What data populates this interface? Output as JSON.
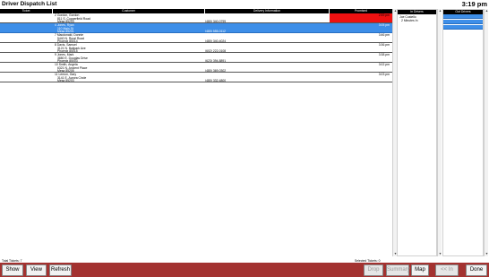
{
  "app": {
    "title": "Driver Dispatch List",
    "clock": "3:19 pm"
  },
  "main": {
    "columns": [
      "Ticket",
      "Customer",
      "Delivery Information",
      "Promised"
    ],
    "rows": [
      {
        "customer": "2 Gordon, Gordon",
        "address": "811 S. Copperfield Road",
        "city": "Mesa 85203",
        "phone": "(480) 340-0799",
        "time": "2:59 pm",
        "selected": false,
        "late": true
      },
      {
        "customer": "4 Jones, Ryan",
        "address": "110 Main St",
        "city": "Mesa 85201",
        "phone": "(480) 555-0112",
        "time": "3:05 pm",
        "selected": true,
        "late": false
      },
      {
        "customer": "7 Macdonald, Donnie",
        "address": "5440 N. Rural Road",
        "city": "Phoenix 85014",
        "phone": "(480) 340-4024",
        "time": "3:46 pm",
        "selected": false,
        "late": false
      },
      {
        "customer": "8 Davis, Samuel",
        "address": "3121 N. Ballpark Ave",
        "city": "Phoenix 85015",
        "phone": "(602) 222-0108",
        "time": "3:36 pm",
        "selected": false,
        "late": false
      },
      {
        "customer": "9 Jones, Mark",
        "address": "3880 E. Douglas Drive",
        "city": "Phoenix 85003",
        "phone": "(623) 394-8891",
        "time": "3:38 pm",
        "selected": false,
        "late": false
      },
      {
        "customer": "10 Smith, Angela",
        "address": "6321 N. Ancient Place",
        "city": "Mesa 85205",
        "phone": "(480) 369-0302",
        "time": "3:02 pm",
        "selected": false,
        "late": false
      },
      {
        "customer": "11 Lemon, Gary",
        "address": "3141 E. Aurora Circle",
        "city": "Mesa 85203",
        "phone": "(480) 332-4800",
        "time": "3:03 pm",
        "selected": false,
        "late": false
      }
    ]
  },
  "in_drivers": {
    "header": "In Drivers",
    "items": [
      "Joe Costello",
      "2 Minutes In"
    ]
  },
  "out_drivers": {
    "header": "Out Drivers"
  },
  "footer": {
    "total_label": "Total Tickets:",
    "total_value": "7",
    "selected_label": "Selected Tickets:",
    "selected_value": "0"
  },
  "buttons": {
    "show": "Show",
    "view": "View",
    "refresh": "Refresh",
    "drop": "Drop",
    "summary": "Summary",
    "map": "Map",
    "in": "<< In",
    "done": "Done"
  },
  "colors": {
    "selected_row": "#3d8ee8",
    "late_promised": "#ee1111",
    "bottom_bar": "#a33230"
  }
}
